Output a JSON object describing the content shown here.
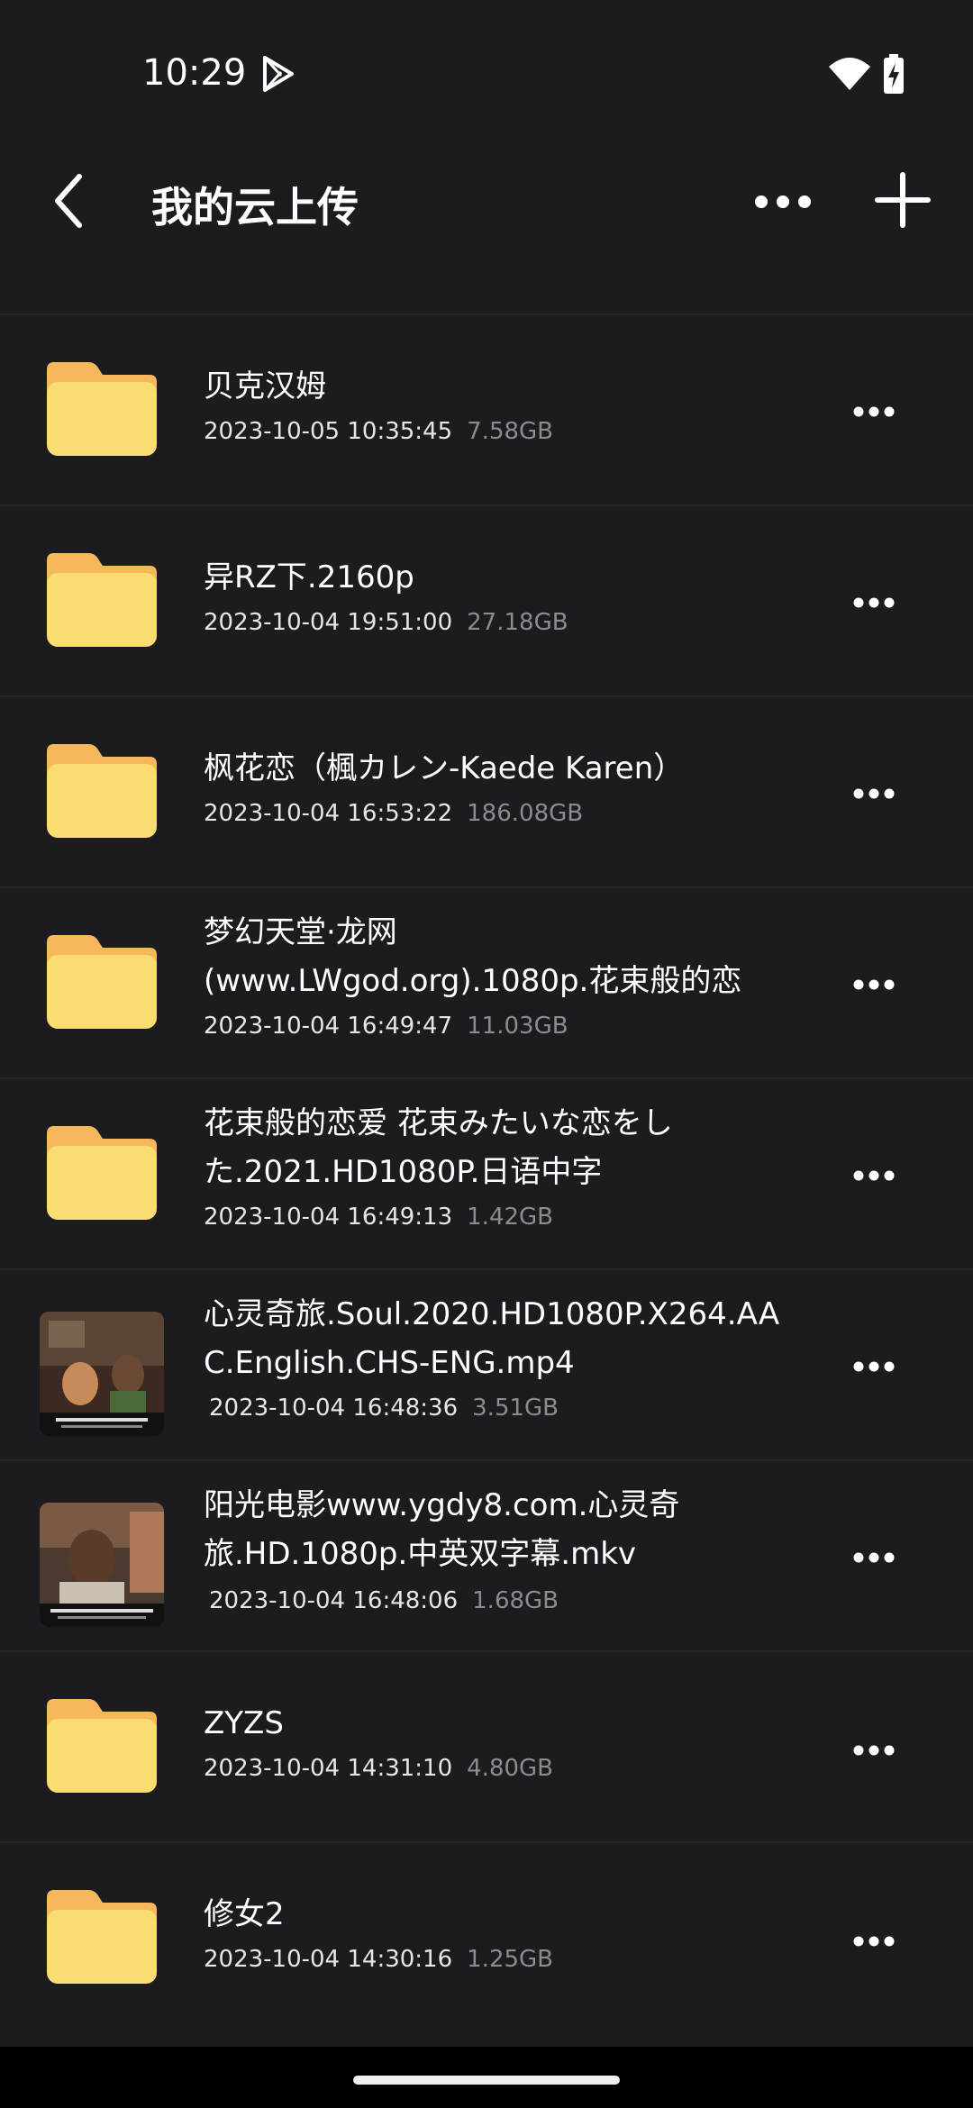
{
  "status_bar": {
    "time": "10:29"
  },
  "app_bar": {
    "title": "我的云上传"
  },
  "items": [
    {
      "type": "folder",
      "name": "贝克汉姆",
      "date": "2023-10-05 10:35:45",
      "size": "7.58GB"
    },
    {
      "type": "folder",
      "name": "异RZ下.2160p",
      "date": "2023-10-04 19:51:00",
      "size": "27.18GB"
    },
    {
      "type": "folder",
      "name": "枫花恋（楓カレン-Kaede Karen）",
      "date": "2023-10-04 16:53:22",
      "size": "186.08GB"
    },
    {
      "type": "folder",
      "name_lines": [
        "梦幻天堂·龙网",
        "(www.LWgod.org).1080p.花束般的恋"
      ],
      "date": "2023-10-04 16:49:47",
      "size": "11.03GB"
    },
    {
      "type": "folder",
      "name_lines": [
        "花束般的恋爱 花束みたいな恋をし",
        "た.2021.HD1080P.日语中字"
      ],
      "date": "2023-10-04 16:49:13",
      "size": "1.42GB"
    },
    {
      "type": "video",
      "name_lines": [
        "心灵奇旅.Soul.2020.HD1080P.X264.AA",
        "C.English.CHS-ENG.mp4"
      ],
      "date": "2023-10-04 16:48:36",
      "size": "3.51GB"
    },
    {
      "type": "video",
      "name_lines": [
        "阳光电影www.ygdy8.com.心灵奇",
        "旅.HD.1080p.中英双字幕.mkv"
      ],
      "date": "2023-10-04 16:48:06",
      "size": "1.68GB"
    },
    {
      "type": "folder",
      "name": "ZYZS",
      "date": "2023-10-04 14:31:10",
      "size": "4.80GB"
    },
    {
      "type": "folder",
      "name": "修女2",
      "date": "2023-10-04 14:30:16",
      "size": "1.25GB"
    }
  ],
  "colors": {
    "background": "#1c1b20",
    "folder": "#fbdc72",
    "folder_tab": "#f5b95c",
    "divider": "#26252a"
  }
}
